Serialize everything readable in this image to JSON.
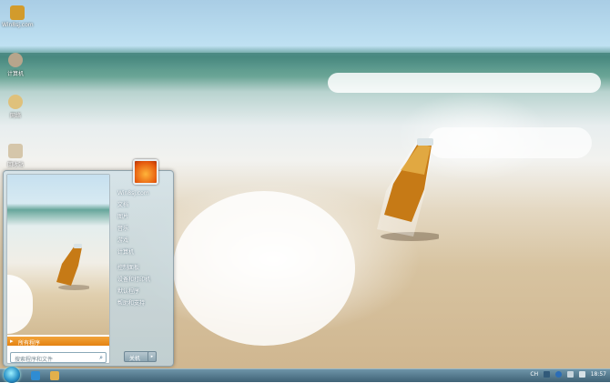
{
  "desktop": {
    "icons": [
      {
        "label": "Win8sj.com",
        "color": "#d29b2c"
      },
      {
        "label": "计算机",
        "color": "#b7a58c"
      },
      {
        "label": "网络",
        "color": "#dfc17b"
      },
      {
        "label": "回收站",
        "color": "#d5c6aa"
      }
    ]
  },
  "start_menu": {
    "all_programs_label": "所有程序",
    "search_placeholder": "搜索程序和文件",
    "right_links": [
      "Win8sj.com",
      "文档",
      "图片",
      "音乐",
      "游戏",
      "计算机",
      "控制面板",
      "设备和打印机",
      "默认程序",
      "帮助和支持"
    ],
    "shutdown_label": "关机",
    "user_picture_colors": [
      "#ffb43a",
      "#e55a0d"
    ]
  },
  "taskbar": {
    "tray": {
      "language": "CH",
      "time": "18:57"
    }
  }
}
